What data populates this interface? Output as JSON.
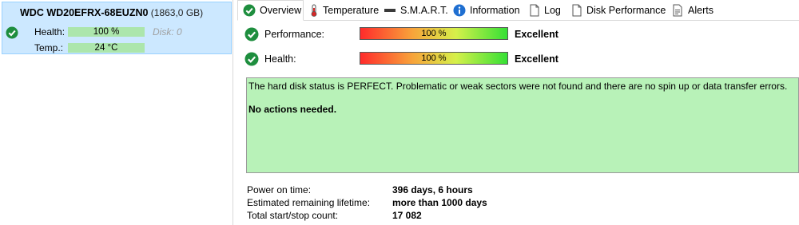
{
  "disk": {
    "name": "WDC WD20EFRX-68EUZN0",
    "size": "(1863,0 GB)",
    "health_label": "Health:",
    "health_value": "100 %",
    "temp_label": "Temp.:",
    "temp_value": "24 °C",
    "disk_number": "Disk: 0"
  },
  "tabs": [
    {
      "label": "Overview",
      "icon": "check-circle-icon"
    },
    {
      "label": "Temperature",
      "icon": "thermometer-icon"
    },
    {
      "label": "S.M.A.R.T.",
      "icon": "smart-icon"
    },
    {
      "label": "Information",
      "icon": "info-icon"
    },
    {
      "label": "Log",
      "icon": "document-icon"
    },
    {
      "label": "Disk Performance",
      "icon": "document-icon"
    },
    {
      "label": "Alerts",
      "icon": "alerts-icon"
    }
  ],
  "overview": {
    "performance_label": "Performance:",
    "performance_value": "100 %",
    "performance_rating": "Excellent",
    "health_label": "Health:",
    "health_value": "100 %",
    "health_rating": "Excellent"
  },
  "status": {
    "message": "The hard disk status is PERFECT. Problematic or weak sectors were not found and there are no spin up or data transfer errors.",
    "action": "No actions needed."
  },
  "stats": {
    "power_on_label": "Power on time:",
    "power_on_value": "396 days, 6 hours",
    "lifetime_label": "Estimated remaining lifetime:",
    "lifetime_value": "more than 1000 days",
    "start_stop_label": "Total start/stop count:",
    "start_stop_value": "17 082"
  },
  "colors": {
    "selection_bg": "#cce8ff",
    "status_bg": "#b8f2b8",
    "bar_green": "#ace6ac",
    "ok_icon": "#1e8e3e"
  }
}
